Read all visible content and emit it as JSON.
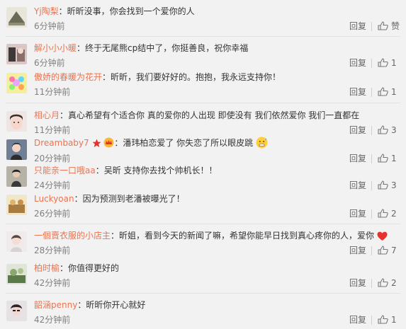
{
  "comments": [
    {
      "user": "Yj陶梨",
      "text": "：昕昕没事，你会找到一个爱你的人",
      "time": "6分钟前",
      "reply": "回复",
      "like": "赞"
    },
    {
      "user": "解小小小暖",
      "text": "：终于无尾熊cp结中了，你挺善良，祝你幸福",
      "time": "6分钟前",
      "reply": "回复",
      "like": "1"
    },
    {
      "user": "傲娇的春暖为花开",
      "text": "：昕昕，我们要好好的。抱抱，我永远支持你！",
      "time": "11分钟前",
      "reply": "回复",
      "like": "1"
    },
    {
      "user": "相心月",
      "text": "：真心希望有个适合你   真的爱你的人出现   即使没有   我们依然爱你   我们一直都在",
      "time": "11分钟前",
      "reply": "回复",
      "like": "3"
    },
    {
      "user": "Dreambaby7",
      "text": "：潘玮柏恋爱了 你失恋了所以眼皮跳",
      "time": "20分钟前",
      "reply": "回复",
      "like": "1"
    },
    {
      "user": "只能亲一口哦aa",
      "text": "：吴昕 支持你去找个帅机长！！",
      "time": "24分钟前",
      "reply": "回复",
      "like": "3"
    },
    {
      "user": "Luckyoan",
      "text": "：因为预测到老潘被曝光了！",
      "time": "26分钟前",
      "reply": "回复",
      "like": "2"
    },
    {
      "user": "一個賣衣服的小店主",
      "text": "：昕姐，看到今天的新闻了嘛，希望你能早日找到真心疼你的人，爱你",
      "time": "28分钟前",
      "reply": "回复",
      "like": "7"
    },
    {
      "user": "柏时榆",
      "text": "：你值得更好的",
      "time": "42分钟前",
      "reply": "回复",
      "like": "2"
    },
    {
      "user": "韶涵penny",
      "text": "：昕昕你开心就好",
      "time": "42分钟前",
      "reply": "回复",
      "like": "1"
    }
  ],
  "colors": {
    "username": "#eb7350",
    "text": "#333333",
    "time": "#808080",
    "action": "#666666",
    "background": "#f2f2f2"
  },
  "icons": {
    "like": "thumbs-up-icon",
    "badge1": "star-badge-icon",
    "badge2": "vip-crown-icon",
    "emoji1": "nervous-sweat-emoji-icon",
    "emoji2": "red-heart-emoji-icon"
  }
}
